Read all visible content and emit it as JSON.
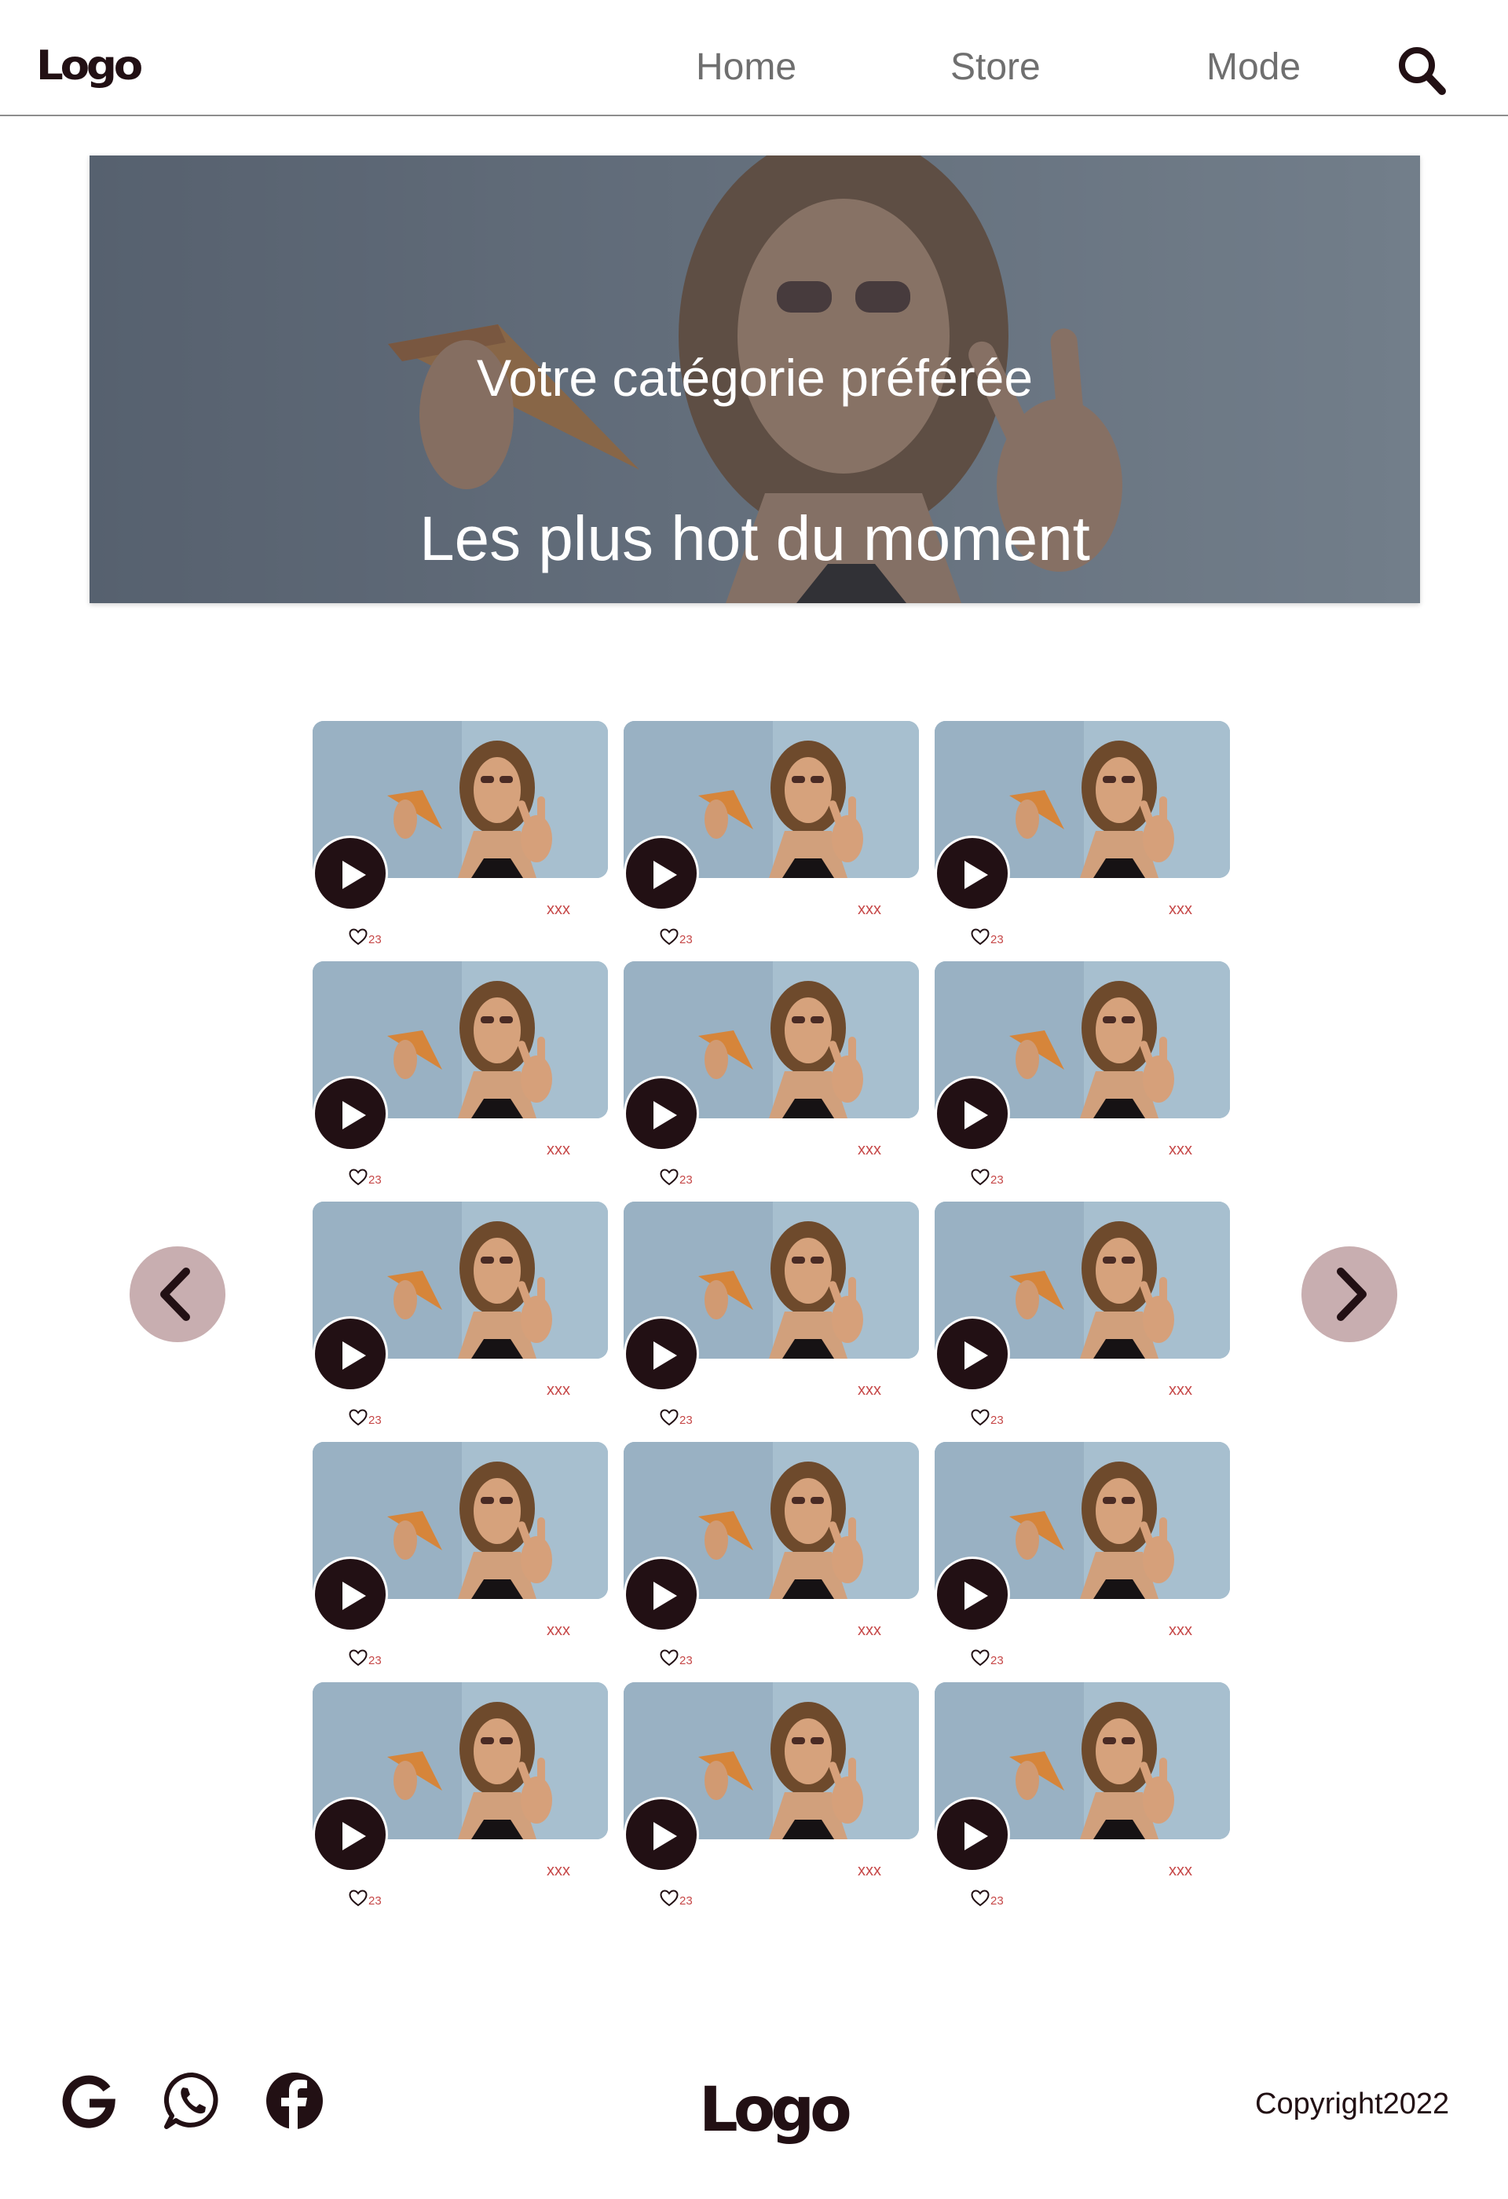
{
  "header": {
    "logo": "Logo",
    "nav": [
      "Home",
      "Store",
      "Mode"
    ],
    "search_icon": "search-icon"
  },
  "hero": {
    "subtitle": "Votre catégorie préférée",
    "title": "Les plus hot du moment"
  },
  "grid": {
    "cards": [
      {
        "tag": "xxx",
        "likes": "23"
      },
      {
        "tag": "xxx",
        "likes": "23"
      },
      {
        "tag": "xxx",
        "likes": "23"
      },
      {
        "tag": "xxx",
        "likes": "23"
      },
      {
        "tag": "xxx",
        "likes": "23"
      },
      {
        "tag": "xxx",
        "likes": "23"
      },
      {
        "tag": "xxx",
        "likes": "23"
      },
      {
        "tag": "xxx",
        "likes": "23"
      },
      {
        "tag": "xxx",
        "likes": "23"
      },
      {
        "tag": "xxx",
        "likes": "23"
      },
      {
        "tag": "xxx",
        "likes": "23"
      },
      {
        "tag": "xxx",
        "likes": "23"
      },
      {
        "tag": "xxx",
        "likes": "23"
      },
      {
        "tag": "xxx",
        "likes": "23"
      },
      {
        "tag": "xxx",
        "likes": "23"
      }
    ]
  },
  "pager": {
    "prev_icon": "chevron-left-icon",
    "next_icon": "chevron-right-icon"
  },
  "footer": {
    "social_icons": [
      "google-icon",
      "whatsapp-icon",
      "facebook-icon"
    ],
    "logo": "Logo",
    "copyright": "Copyright2022"
  },
  "colors": {
    "primary_dark": "#221014",
    "accent_red": "#c64848",
    "arrow_bg": "#c8aeb0",
    "nav_text": "#6f6f6f"
  }
}
